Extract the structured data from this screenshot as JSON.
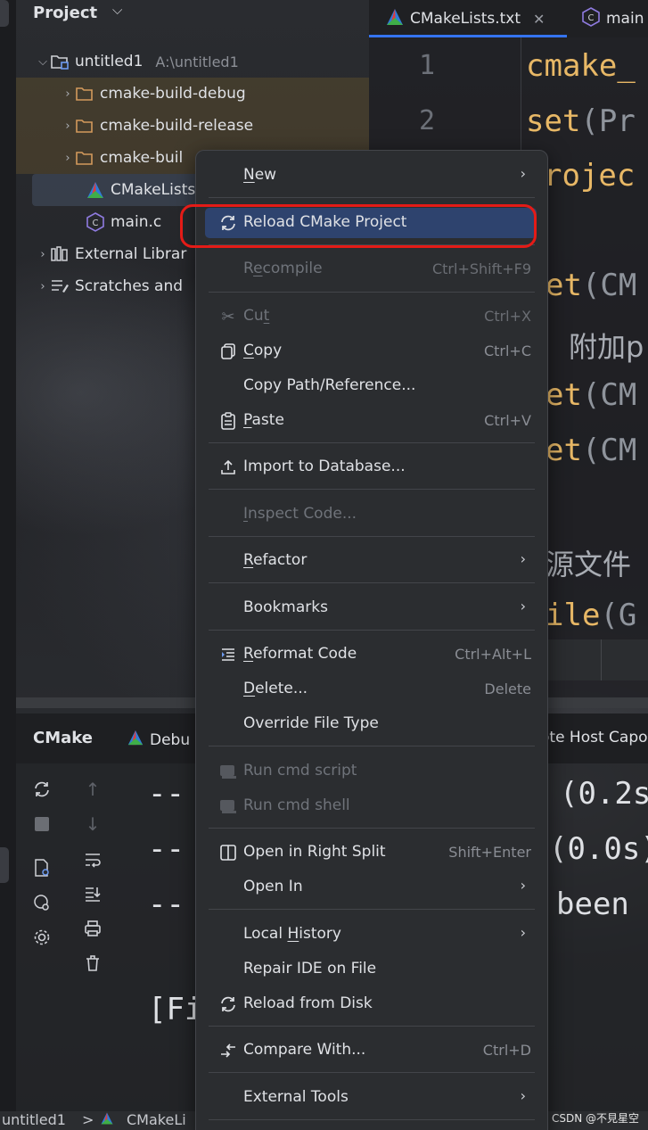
{
  "project": {
    "title": "Project",
    "tree": [
      {
        "label": "untitled1",
        "hint": "A:\\untitled1",
        "icon": "folder-module-icon"
      },
      {
        "label": "cmake-build-debug",
        "icon": "folder-icon"
      },
      {
        "label": "cmake-build-release",
        "icon": "folder-icon"
      },
      {
        "label": "cmake-buil",
        "icon": "folder-icon"
      },
      {
        "label": "CMakeLists",
        "icon": "cmake-icon"
      },
      {
        "label": "main.c",
        "icon": "c-file-icon"
      },
      {
        "label": "External Librar",
        "icon": "library-icon"
      },
      {
        "label": "Scratches and",
        "icon": "scratches-icon"
      }
    ]
  },
  "editor": {
    "tabs": [
      {
        "label": "CMakeLists.txt",
        "active": true
      },
      {
        "label": "main"
      }
    ],
    "line_numbers": [
      "1",
      "2"
    ],
    "code_lines": [
      {
        "kw": "cmake_",
        "rest": ""
      },
      {
        "kw": "set",
        "rest": "(Pr"
      },
      {
        "kw": "rojec",
        "rest": ""
      },
      {
        "kw": "et",
        "rest": "(CM"
      },
      {
        "comment": "附加p"
      },
      {
        "kw": "et",
        "rest": "(CM"
      },
      {
        "kw": "et",
        "rest": "(CM"
      },
      {
        "comment": "源文件"
      },
      {
        "kw": "ile",
        "rest": "(G"
      }
    ]
  },
  "bottom": {
    "tabs": [
      "CMake",
      "Debu",
      "ote Host Capo"
    ],
    "output_lines": [
      "-- ",
      "-- ",
      "-- ",
      "[Fi"
    ],
    "output_right": [
      "(0.2s",
      "(0.0s)",
      "been "
    ]
  },
  "statusbar": {
    "crumbs": [
      "untitled1",
      ">",
      "CMakeLi"
    ],
    "watermark": "CSDN @不見星空"
  },
  "menu": {
    "items": [
      {
        "label": "New",
        "mnemonic": "N",
        "submenu": true
      },
      {
        "label": "Reload CMake Project",
        "icon": "reload-icon",
        "active": true
      },
      {
        "label": "Recompile",
        "mnemonic": "e",
        "shortcut": "Ctrl+Shift+F9",
        "disabled": true
      },
      {
        "label": "Cut",
        "mnemonic": "t",
        "shortcut": "Ctrl+X",
        "icon": "scissors-icon",
        "disabled": true
      },
      {
        "label": "Copy",
        "mnemonic": "C",
        "shortcut": "Ctrl+C",
        "icon": "copy-icon"
      },
      {
        "label": "Copy Path/Reference..."
      },
      {
        "label": "Paste",
        "mnemonic": "P",
        "shortcut": "Ctrl+V",
        "icon": "paste-icon"
      },
      {
        "label": "Import to Database...",
        "icon": "upload-icon"
      },
      {
        "label": "Inspect Code...",
        "disabled": true
      },
      {
        "label": "Refactor",
        "mnemonic": "R",
        "submenu": true
      },
      {
        "label": "Bookmarks",
        "submenu": true
      },
      {
        "label": "Reformat Code",
        "mnemonic": "R",
        "shortcut": "Ctrl+Alt+L",
        "icon": "reformat-icon"
      },
      {
        "label": "Delete...",
        "mnemonic": "D",
        "shortcut": "Delete"
      },
      {
        "label": "Override File Type"
      },
      {
        "label": "Run cmd script",
        "icon": "terminal-icon",
        "disabled": true
      },
      {
        "label": "Run cmd shell",
        "icon": "terminal-icon",
        "disabled": true
      },
      {
        "label": "Open in Right Split",
        "shortcut": "Shift+Enter",
        "icon": "split-icon"
      },
      {
        "label": "Open In",
        "submenu": true
      },
      {
        "label": "Local History",
        "mnemonic": "H",
        "submenu": true
      },
      {
        "label": "Repair IDE on File"
      },
      {
        "label": "Reload from Disk",
        "icon": "reload-icon"
      },
      {
        "label": "Compare With...",
        "shortcut": "Ctrl+D",
        "icon": "compare-icon"
      },
      {
        "label": "External Tools",
        "submenu": true
      }
    ]
  }
}
